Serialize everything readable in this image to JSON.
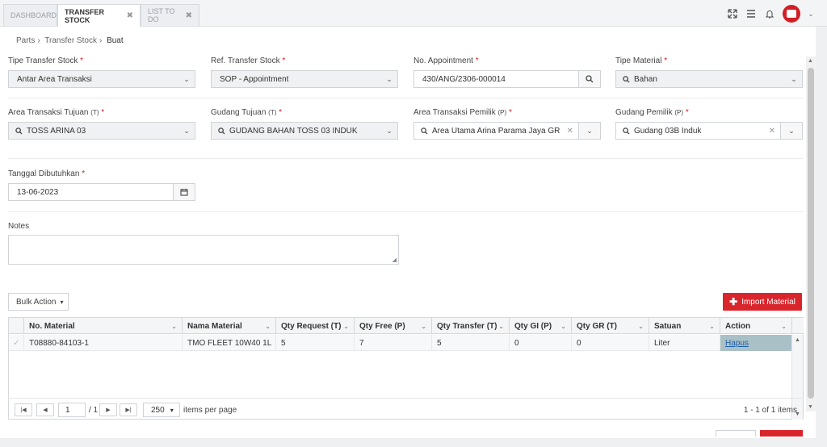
{
  "tabs": [
    {
      "label": "DASHBOARD",
      "active": false,
      "closable": false
    },
    {
      "label": "TRANSFER STOCK",
      "active": true,
      "closable": true
    },
    {
      "label": "LIST TO DO",
      "active": false,
      "closable": true
    }
  ],
  "header_icons": [
    "expand-icon",
    "menu-icon",
    "bell-icon",
    "user-avatar"
  ],
  "breadcrumb": [
    "Parts",
    "Transfer Stock",
    "Buat"
  ],
  "form": {
    "tipe_transfer_stock": {
      "label": "Tipe Transfer Stock",
      "value": "Antar Area Transaksi"
    },
    "ref_transfer_stock": {
      "label": "Ref. Transfer Stock",
      "value": "SOP - Appointment"
    },
    "no_appointment": {
      "label": "No. Appointment",
      "value": "430/ANG/2306-000014"
    },
    "tipe_material": {
      "label": "Tipe Material",
      "value": "Bahan"
    },
    "area_transaksi_tujuan": {
      "label": "Area Transaksi Tujuan",
      "tag": "(T)",
      "value": "TOSS ARINA 03"
    },
    "gudang_tujuan": {
      "label": "Gudang Tujuan",
      "tag": "(T)",
      "value": "GUDANG BAHAN TOSS 03 INDUK"
    },
    "area_transaksi_pemilik": {
      "label": "Area Transaksi Pemilik",
      "tag": "(P)",
      "value": "Area Utama Arina Parama Jaya GR"
    },
    "gudang_pemilik": {
      "label": "Gudang Pemilik",
      "tag": "(P)",
      "value": "Gudang 03B Induk"
    },
    "tanggal_dibutuhkan": {
      "label": "Tanggal Dibutuhkan",
      "value": "13-06-2023"
    },
    "notes": {
      "label": "Notes",
      "value": ""
    }
  },
  "toolbar": {
    "bulk_action": "Bulk Action",
    "import_material": "Import Material"
  },
  "grid": {
    "columns": [
      "No. Material",
      "Nama Material",
      "Qty Request (T)",
      "Qty Free (P)",
      "Qty Transfer (T)",
      "Qty GI (P)",
      "Qty GR (T)",
      "Satuan",
      "Action"
    ],
    "rows": [
      {
        "no_material": "T08880-84103-1",
        "nama_material": "TMO FLEET 10W40 1L",
        "qty_request": "5",
        "qty_free": "7",
        "qty_transfer": "5",
        "qty_gi": "0",
        "qty_gr": "0",
        "satuan": "Liter",
        "action": "Hapus"
      }
    ]
  },
  "pager": {
    "page": "1",
    "of": "/ 1",
    "page_size": "250",
    "items_per_page": "items per page",
    "summary": "1 - 1 of 1 items"
  },
  "colors": {
    "accent": "#d9262d",
    "action_cell": "#a9c0c7"
  }
}
